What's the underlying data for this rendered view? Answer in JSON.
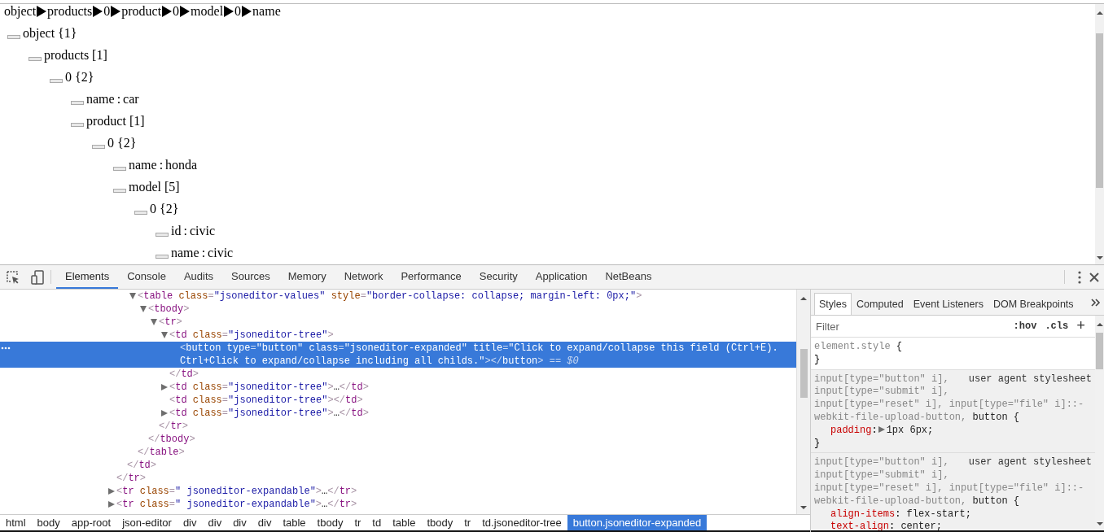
{
  "breadcrumb": [
    "object",
    "products",
    "0",
    "product",
    "0",
    "model",
    "0",
    "name"
  ],
  "tree": [
    {
      "key": "object",
      "count": "{1}",
      "children": [
        {
          "key": "products",
          "count": "[1]",
          "children": [
            {
              "key": "0",
              "count": "{2}",
              "children": [
                {
                  "key": "name",
                  "separator": ":",
                  "value": "car"
                },
                {
                  "key": "product",
                  "count": "[1]",
                  "children": [
                    {
                      "key": "0",
                      "count": "{2}",
                      "children": [
                        {
                          "key": "name",
                          "separator": ":",
                          "value": "honda"
                        },
                        {
                          "key": "model",
                          "count": "[5]",
                          "children": [
                            {
                              "key": "0",
                              "count": "{2}",
                              "children": [
                                {
                                  "key": "id",
                                  "separator": ":",
                                  "value": "civic"
                                },
                                {
                                  "key": "name",
                                  "separator": ":",
                                  "value": "civic"
                                }
                              ]
                            }
                          ]
                        }
                      ]
                    }
                  ]
                }
              ]
            }
          ]
        }
      ]
    }
  ],
  "devtools": {
    "tabs": [
      {
        "label": "Elements",
        "selected": true
      },
      {
        "label": "Console",
        "selected": false
      },
      {
        "label": "Audits",
        "selected": false
      },
      {
        "label": "Sources",
        "selected": false
      },
      {
        "label": "Memory",
        "selected": false
      },
      {
        "label": "Network",
        "selected": false
      },
      {
        "label": "Performance",
        "selected": false
      },
      {
        "label": "Security",
        "selected": false
      },
      {
        "label": "Application",
        "selected": false
      },
      {
        "label": "NetBeans",
        "selected": false
      }
    ],
    "dom_tree": [
      {
        "children": [
          {
            "children": [
              {
                "selected": false,
                "expanded": true,
                "open": [
                  {
                    "kind": "punct",
                    "s": "<"
                  },
                  {
                    "kind": "tag",
                    "s": "table"
                  },
                  {
                    "kind": "attr",
                    "s": " class"
                  },
                  {
                    "kind": "punct",
                    "s": "="
                  },
                  {
                    "kind": "value",
                    "s": "\"jsoneditor-values\""
                  },
                  {
                    "kind": "attr",
                    "s": " style"
                  },
                  {
                    "kind": "punct",
                    "s": "="
                  },
                  {
                    "kind": "value",
                    "s": "\"border-collapse: collapse; margin-left: 0px;\""
                  },
                  {
                    "kind": "punct",
                    "s": ">"
                  }
                ],
                "children": [
                  {
                    "selected": false,
                    "expanded": true,
                    "open": [
                      {
                        "kind": "punct",
                        "s": "<"
                      },
                      {
                        "kind": "tag",
                        "s": "tbody"
                      },
                      {
                        "kind": "punct",
                        "s": ">"
                      }
                    ],
                    "children": [
                      {
                        "selected": false,
                        "expanded": true,
                        "open": [
                          {
                            "kind": "punct",
                            "s": "<"
                          },
                          {
                            "kind": "tag",
                            "s": "tr"
                          },
                          {
                            "kind": "punct",
                            "s": ">"
                          }
                        ],
                        "children": [
                          {
                            "selected": false,
                            "expanded": true,
                            "open": [
                              {
                                "kind": "punct",
                                "s": "<"
                              },
                              {
                                "kind": "tag",
                                "s": "td"
                              },
                              {
                                "kind": "attr",
                                "s": " class"
                              },
                              {
                                "kind": "punct",
                                "s": "="
                              },
                              {
                                "kind": "value",
                                "s": "\"jsoneditor-tree\""
                              },
                              {
                                "kind": "punct",
                                "s": ">"
                              }
                            ],
                            "children": [
                              {
                                "selected": true,
                                "open": [
                                  {
                                    "kind": "punct",
                                    "s": "<"
                                  },
                                  {
                                    "kind": "tag",
                                    "s": "button"
                                  },
                                  {
                                    "kind": "attr",
                                    "s": " type"
                                  },
                                  {
                                    "kind": "punct",
                                    "s": "="
                                  },
                                  {
                                    "kind": "value",
                                    "s": "\"button\""
                                  },
                                  {
                                    "kind": "attr",
                                    "s": " class"
                                  },
                                  {
                                    "kind": "punct",
                                    "s": "="
                                  },
                                  {
                                    "kind": "value",
                                    "s": "\"jsoneditor-expanded\""
                                  },
                                  {
                                    "kind": "attr",
                                    "s": " title"
                                  },
                                  {
                                    "kind": "punct",
                                    "s": "="
                                  },
                                  {
                                    "kind": "value",
                                    "s": "\"Click to expand/collapse this field (Ctrl+E)."
                                  }
                                ],
                                "open_more": [
                                  {
                                    "kind": "value",
                                    "s": "Ctrl+Click to expand/collapse including all childs.\""
                                  },
                                  {
                                    "kind": "punct",
                                    "s": "></"
                                  },
                                  {
                                    "kind": "tag",
                                    "s": "button"
                                  },
                                  {
                                    "kind": "punct",
                                    "s": ">"
                                  },
                                  {
                                    "kind": "marker",
                                    "s": " == $0"
                                  }
                                ]
                              }
                            ],
                            "close": [
                              {
                                "kind": "punct",
                                "s": "</"
                              },
                              {
                                "kind": "tag",
                                "s": "td"
                              },
                              {
                                "kind": "punct",
                                "s": ">"
                              }
                            ]
                          },
                          {
                            "selected": false,
                            "expanded": false,
                            "open": [
                              {
                                "kind": "punct",
                                "s": "<"
                              },
                              {
                                "kind": "tag",
                                "s": "td"
                              },
                              {
                                "kind": "attr",
                                "s": " class"
                              },
                              {
                                "kind": "punct",
                                "s": "="
                              },
                              {
                                "kind": "value",
                                "s": "\"jsoneditor-tree\""
                              },
                              {
                                "kind": "punct",
                                "s": ">"
                              },
                              {
                                "kind": "text",
                                "s": "…"
                              }
                            ],
                            "close": [
                              {
                                "kind": "punct",
                                "s": "</"
                              },
                              {
                                "kind": "tag",
                                "s": "td"
                              },
                              {
                                "kind": "punct",
                                "s": ">"
                              }
                            ]
                          },
                          {
                            "selected": false,
                            "open": [
                              {
                                "kind": "punct",
                                "s": "<"
                              },
                              {
                                "kind": "tag",
                                "s": "td"
                              },
                              {
                                "kind": "attr",
                                "s": " class"
                              },
                              {
                                "kind": "punct",
                                "s": "="
                              },
                              {
                                "kind": "value",
                                "s": "\"jsoneditor-tree\""
                              },
                              {
                                "kind": "punct",
                                "s": ">"
                              }
                            ],
                            "close": [
                              {
                                "kind": "punct",
                                "s": "</"
                              },
                              {
                                "kind": "tag",
                                "s": "td"
                              },
                              {
                                "kind": "punct",
                                "s": ">"
                              }
                            ]
                          },
                          {
                            "selected": false,
                            "expanded": false,
                            "open": [
                              {
                                "kind": "punct",
                                "s": "<"
                              },
                              {
                                "kind": "tag",
                                "s": "td"
                              },
                              {
                                "kind": "attr",
                                "s": " class"
                              },
                              {
                                "kind": "punct",
                                "s": "="
                              },
                              {
                                "kind": "value",
                                "s": "\"jsoneditor-tree\""
                              },
                              {
                                "kind": "punct",
                                "s": ">"
                              },
                              {
                                "kind": "text",
                                "s": "…"
                              }
                            ],
                            "close": [
                              {
                                "kind": "punct",
                                "s": "</"
                              },
                              {
                                "kind": "tag",
                                "s": "td"
                              },
                              {
                                "kind": "punct",
                                "s": ">"
                              }
                            ]
                          }
                        ],
                        "close": [
                          {
                            "kind": "punct",
                            "s": "</"
                          },
                          {
                            "kind": "tag",
                            "s": "tr"
                          },
                          {
                            "kind": "punct",
                            "s": ">"
                          }
                        ]
                      }
                    ],
                    "close": [
                      {
                        "kind": "punct",
                        "s": "</"
                      },
                      {
                        "kind": "tag",
                        "s": "tbody"
                      },
                      {
                        "kind": "punct",
                        "s": ">"
                      }
                    ]
                  }
                ],
                "close": [
                  {
                    "kind": "punct",
                    "s": "</"
                  },
                  {
                    "kind": "tag",
                    "s": "table"
                  },
                  {
                    "kind": "punct",
                    "s": ">"
                  }
                ]
              }
            ],
            "close": [
              {
                "kind": "punct",
                "s": "</"
              },
              {
                "kind": "tag",
                "s": "td"
              },
              {
                "kind": "punct",
                "s": ">"
              }
            ]
          }
        ],
        "close": [
          {
            "kind": "punct",
            "s": "</"
          },
          {
            "kind": "tag",
            "s": "tr"
          },
          {
            "kind": "punct",
            "s": ">"
          }
        ]
      },
      {
        "selected": false,
        "expanded": false,
        "open": [
          {
            "kind": "punct",
            "s": "<"
          },
          {
            "kind": "tag",
            "s": "tr"
          },
          {
            "kind": "attr",
            "s": " class"
          },
          {
            "kind": "punct",
            "s": "="
          },
          {
            "kind": "value",
            "s": "\" jsoneditor-expandable\""
          },
          {
            "kind": "punct",
            "s": ">"
          },
          {
            "kind": "text",
            "s": "…"
          }
        ],
        "close": [
          {
            "kind": "punct",
            "s": "</"
          },
          {
            "kind": "tag",
            "s": "tr"
          },
          {
            "kind": "punct",
            "s": ">"
          }
        ]
      },
      {
        "selected": false,
        "expanded": false,
        "open": [
          {
            "kind": "punct",
            "s": "<"
          },
          {
            "kind": "tag",
            "s": "tr"
          },
          {
            "kind": "attr",
            "s": " class"
          },
          {
            "kind": "punct",
            "s": "="
          },
          {
            "kind": "value",
            "s": "\" jsoneditor-expandable\""
          },
          {
            "kind": "punct",
            "s": ">"
          },
          {
            "kind": "text",
            "s": "…"
          }
        ],
        "close": [
          {
            "kind": "punct",
            "s": "</"
          },
          {
            "kind": "tag",
            "s": "tr"
          },
          {
            "kind": "punct",
            "s": ">"
          }
        ]
      }
    ],
    "dom_path": [
      {
        "label": "html",
        "selected": false
      },
      {
        "label": "body",
        "selected": false
      },
      {
        "label": "app-root",
        "selected": false
      },
      {
        "label": "json-editor",
        "selected": false
      },
      {
        "label": "div",
        "selected": false
      },
      {
        "label": "div",
        "selected": false
      },
      {
        "label": "div",
        "selected": false
      },
      {
        "label": "div",
        "selected": false
      },
      {
        "label": "table",
        "selected": false
      },
      {
        "label": "tbody",
        "selected": false
      },
      {
        "label": "tr",
        "selected": false
      },
      {
        "label": "td",
        "selected": false
      },
      {
        "label": "table",
        "selected": false
      },
      {
        "label": "tbody",
        "selected": false
      },
      {
        "label": "tr",
        "selected": false
      },
      {
        "label": "td.jsoneditor-tree",
        "selected": false
      },
      {
        "label": "button.jsoneditor-expanded",
        "selected": true
      }
    ],
    "styles_pane": {
      "tabs": [
        {
          "label": "Styles",
          "selected": true
        },
        {
          "label": "Computed",
          "selected": false
        },
        {
          "label": "Event Listeners",
          "selected": false
        },
        {
          "label": "DOM Breakpoints",
          "selected": false
        }
      ],
      "filter": {
        "placeholder": "Filter"
      },
      "hov": ":hov",
      "cls": ".cls",
      "add": "+",
      "rules": [
        {
          "kind": "inline",
          "selector_lines": [
            "element.style"
          ],
          "brace_open": " {",
          "brace_close": "}"
        },
        {
          "kind": "ua",
          "selector_lines": [
            "input[type=\"button\" i],",
            "input[type=\"submit\" i],",
            "input[type=\"reset\" i], input[type=\"file\" i]::-",
            "webkit-file-upload-button, "
          ],
          "matched": "button",
          "brace_open": " {",
          "source": "user agent stylesheet",
          "properties": [
            {
              "name": "padding",
              "colon": ":",
              "value": "1px 6px;",
              "expandable": true
            }
          ],
          "brace_close": "}"
        },
        {
          "kind": "ua",
          "selector_lines": [
            "input[type=\"button\" i],",
            "input[type=\"submit\" i],",
            "input[type=\"reset\" i], input[type=\"file\" i]::-",
            "webkit-file-upload-button, "
          ],
          "matched": "button",
          "brace_open": " {",
          "source": "user agent stylesheet",
          "properties": [
            {
              "name": "align-items",
              "colon": ":",
              "value": " flex-start;",
              "expandable": false
            },
            {
              "name": "text-align",
              "colon": ":",
              "value": " center;",
              "expandable": false
            }
          ]
        }
      ]
    }
  }
}
